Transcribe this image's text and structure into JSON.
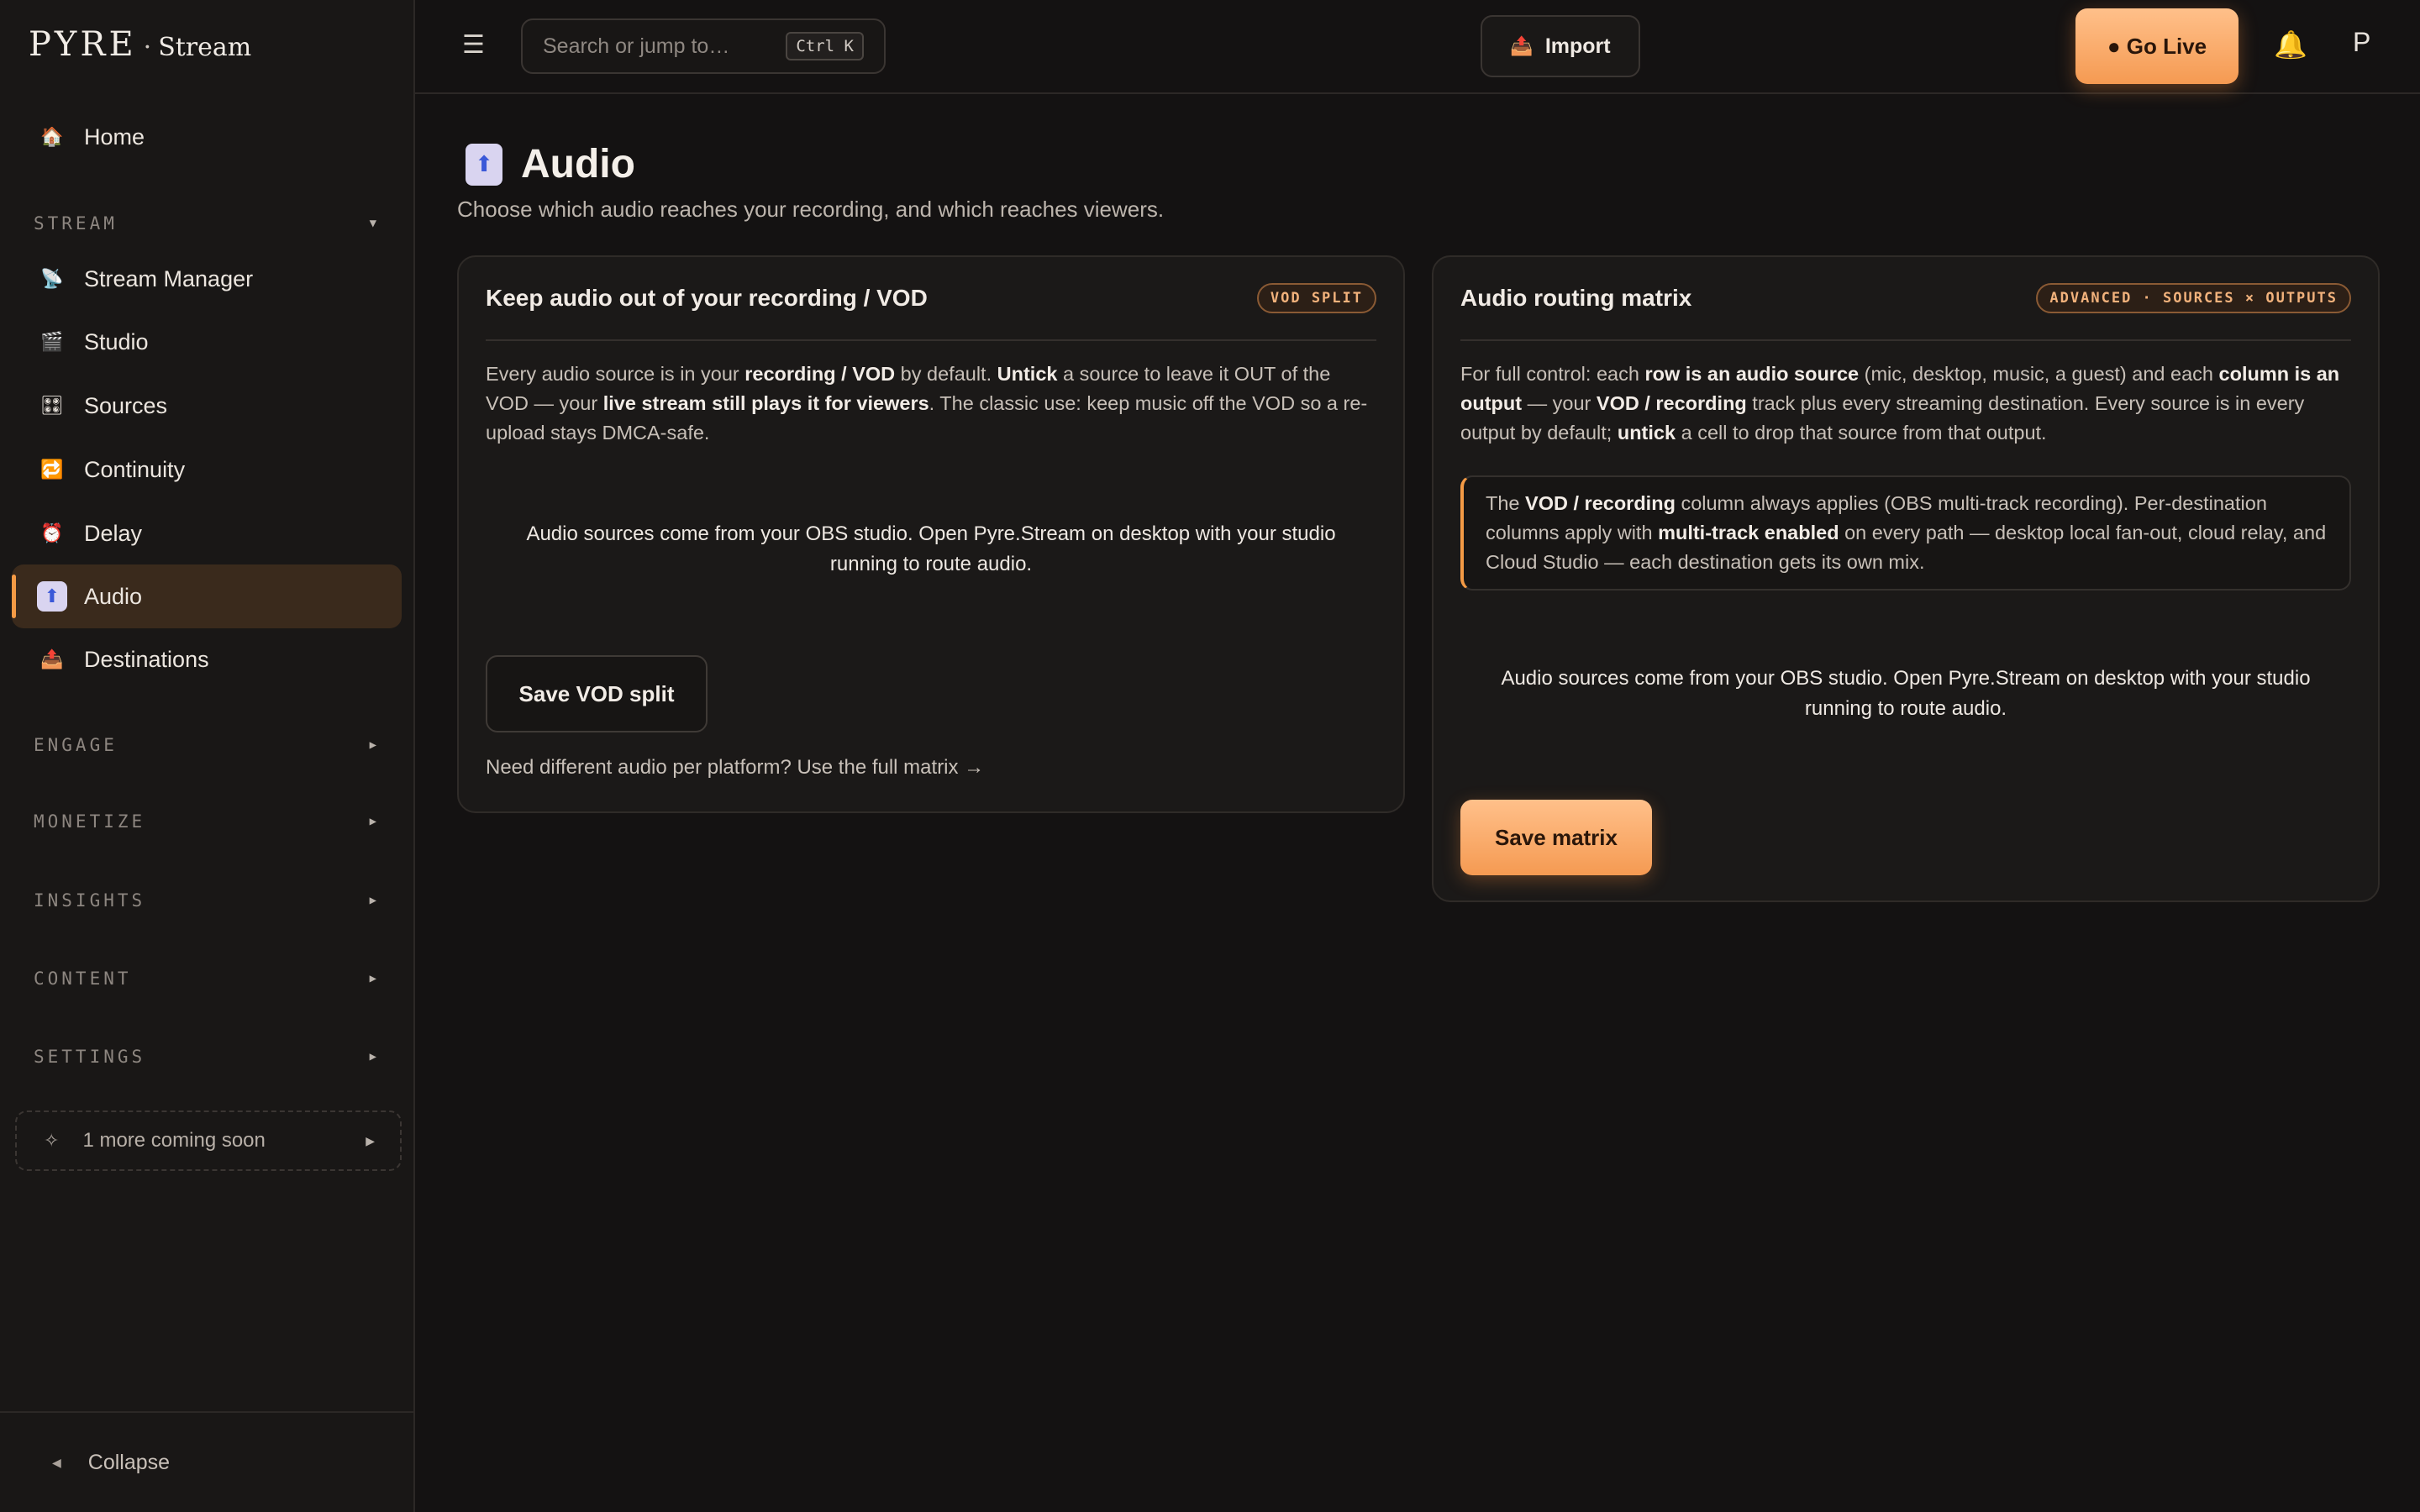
{
  "app": {
    "brand": "PYRE",
    "brand_dot": "·",
    "brand_sub": "Stream"
  },
  "sidebar": {
    "home": {
      "label": "Home",
      "icon": "house-icon"
    },
    "stream_section": "STREAM",
    "stream_items": [
      {
        "label": "Stream Manager",
        "icon": "satellite-dish-icon"
      },
      {
        "label": "Studio",
        "icon": "clapperboard-icon"
      },
      {
        "label": "Sources",
        "icon": "control-knobs-icon"
      },
      {
        "label": "Continuity",
        "icon": "repeat-icon"
      },
      {
        "label": "Delay",
        "icon": "alarm-clock-icon"
      },
      {
        "label": "Audio",
        "icon": "audio-upload-icon",
        "active": true
      },
      {
        "label": "Destinations",
        "icon": "outbox-tray-icon"
      }
    ],
    "sections": [
      "ENGAGE",
      "MONETIZE",
      "INSIGHTS",
      "CONTENT",
      "SETTINGS"
    ],
    "coming_soon": "1 more coming soon",
    "collapse": "Collapse"
  },
  "topbar": {
    "search_placeholder": "Search or jump to…",
    "search_shortcut": "Ctrl K",
    "import_label": "Import",
    "go_live_label": "● Go Live",
    "avatar_initial": "P"
  },
  "page": {
    "title": "Audio",
    "subtitle": "Choose which audio reaches your recording, and which reaches viewers."
  },
  "vod_card": {
    "title": "Keep audio out of your recording / VOD",
    "badge": "VOD SPLIT",
    "desc": [
      {
        "t": "Every audio source is in your "
      },
      {
        "t": "recording / VOD",
        "b": true
      },
      {
        "t": " by default. "
      },
      {
        "t": "Untick",
        "b": true
      },
      {
        "t": " a source to leave it OUT of the VOD — your "
      },
      {
        "t": "live stream still plays it for viewers",
        "b": true
      },
      {
        "t": ". The classic use: keep music off the VOD so a re-upload stays DMCA-safe."
      }
    ],
    "empty_note": "Audio sources come from your OBS studio. Open Pyre.Stream on desktop with your studio running to route audio.",
    "save_label": "Save VOD split",
    "matrix_link": "Need different audio per platform? Use the full matrix →"
  },
  "matrix_card": {
    "title": "Audio routing matrix",
    "badge": "ADVANCED · SOURCES × OUTPUTS",
    "desc": [
      {
        "t": "For full control: each "
      },
      {
        "t": "row is an audio source",
        "b": true
      },
      {
        "t": " (mic, desktop, music, a guest) and each "
      },
      {
        "t": "column is an output",
        "b": true
      },
      {
        "t": " — your "
      },
      {
        "t": "VOD / recording",
        "b": true
      },
      {
        "t": " track plus every streaming destination. Every source is in every output by default; "
      },
      {
        "t": "untick",
        "b": true
      },
      {
        "t": " a cell to drop that source from that output."
      }
    ],
    "callout": [
      {
        "t": "The "
      },
      {
        "t": "VOD / recording",
        "b": true
      },
      {
        "t": " column always applies (OBS multi-track recording). Per-destination columns apply with "
      },
      {
        "t": "multi-track enabled",
        "b": true
      },
      {
        "t": " on every path — desktop local fan-out, cloud relay, and Cloud Studio — each destination gets its own mix."
      }
    ],
    "empty_note": "Audio sources come from your OBS studio. Open Pyre.Stream on desktop with your studio running to route audio.",
    "save_label": "Save matrix"
  },
  "colors": {
    "accent": "#f49a45",
    "background": "#141212",
    "sidebar": "#191716",
    "card": "#1b1918"
  }
}
